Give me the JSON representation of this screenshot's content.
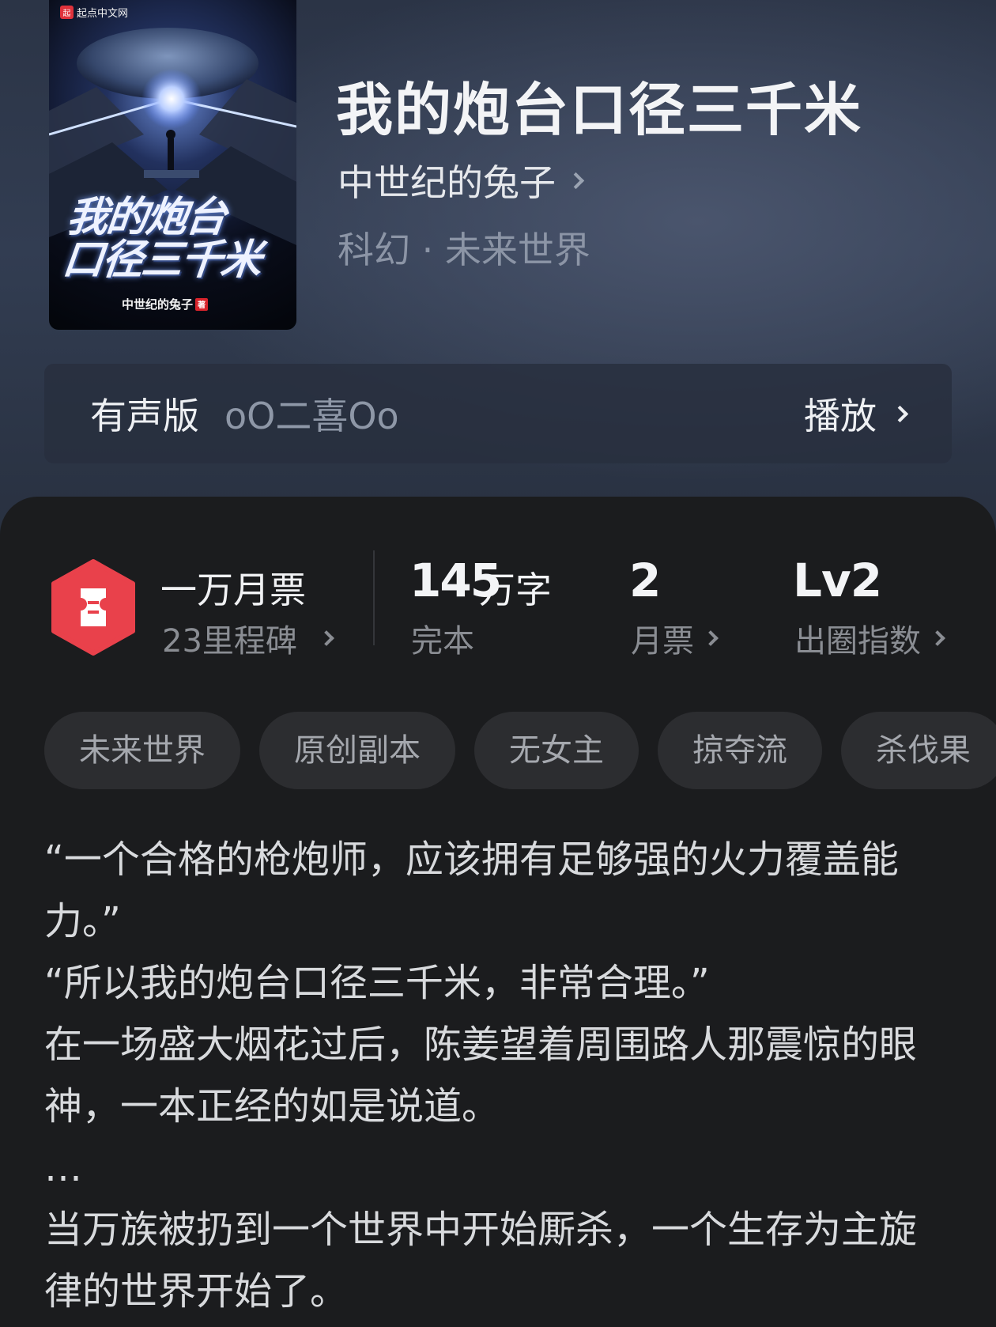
{
  "book": {
    "title": "我的炮台口径三千米",
    "author": "中世纪的兔子",
    "genre": "科幻 · 未来世界",
    "cover": {
      "publisher": "起点中文网",
      "publisher_logo": "起",
      "title_line1": "我的炮台",
      "title_line2": "口径三千米",
      "author": "中世纪的兔子",
      "author_mark": "著"
    }
  },
  "audio": {
    "label": "有声版",
    "narrator": "oO二喜Oo",
    "play_label": "播放"
  },
  "stats": {
    "monthly_ticket_title": "一万月票",
    "milestone": "23里程碑",
    "word_count": "145",
    "word_unit": "万字",
    "status": "完本",
    "monthly_votes": "2",
    "monthly_votes_label": "月票",
    "level": "Lv2",
    "level_label": "出圈指数"
  },
  "tags": [
    "未来世界",
    "原创副本",
    "无女主",
    "掠夺流",
    "杀伐果"
  ],
  "description": [
    "“一个合格的枪炮师，应该拥有足够强的火力覆盖能力。”",
    "“所以我的炮台口径三千米，非常合理。”",
    "在一场盛大烟花过后，陈姜望着周围路人那震惊的眼神，一本正经的如是说道。",
    "…",
    "当万族被扔到一个世界中开始厮杀，一个生存为主旋律的世界开始了。"
  ],
  "colors": {
    "header_bg": "#323d52",
    "card_bg": "#1b1c1e",
    "badge_red": "#e9414b",
    "tag_bg": "#2c2d30"
  }
}
